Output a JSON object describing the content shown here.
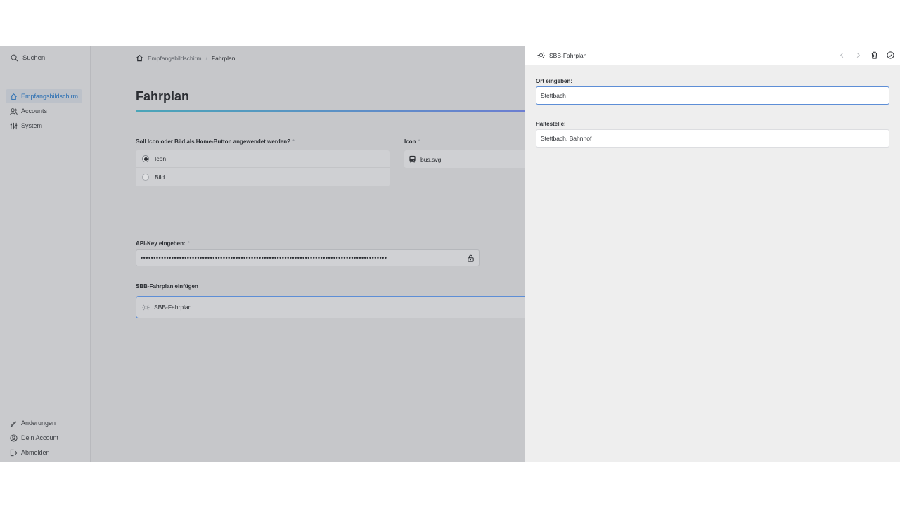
{
  "sidebar": {
    "search_label": "Suchen",
    "nav": [
      {
        "label": "Empfangsbildschirm",
        "icon": "home-icon",
        "active": true
      },
      {
        "label": "Accounts",
        "icon": "users-icon",
        "active": false
      },
      {
        "label": "System",
        "icon": "sliders-icon",
        "active": false
      }
    ],
    "bottom": [
      {
        "label": "Änderungen",
        "icon": "pencil-icon"
      },
      {
        "label": "Dein Account",
        "icon": "account-icon"
      },
      {
        "label": "Abmelden",
        "icon": "logout-icon"
      }
    ]
  },
  "main": {
    "breadcrumb": {
      "root": "Empfangsbildschirm",
      "separator": "/",
      "current": "Fahrplan"
    },
    "title": "Fahrplan",
    "home_button_question": "Soll Icon oder Bild als Home-Button angewendet werden?",
    "required_marker": "*",
    "radio_options": [
      {
        "label": "Icon",
        "selected": true
      },
      {
        "label": "Bild",
        "selected": false
      }
    ],
    "icon_label": "Icon",
    "icon_value": "bus.svg",
    "api_key_label": "API-Key eingeben:",
    "api_key_masked": "••••••••••••••••••••••••••••••••••••••••••••••••••••••••••••••••••••••••••••••••••••••••••••••••",
    "sbb_insert_label": "SBB-Fahrplan einfügen",
    "sbb_block_label": "SBB-Fahrplan"
  },
  "panel": {
    "title": "SBB-Fahrplan",
    "location_label": "Ort eingeben:",
    "location_value": "Stettbach",
    "stop_label": "Haltestelle:",
    "stop_value": "Stettbach, Bahnhof"
  },
  "colors": {
    "accent": "#2a6fb3",
    "focus_border": "#5d8ed6",
    "title_gradient_start": "#4aa5b8",
    "title_gradient_end": "#6c7ed1"
  }
}
